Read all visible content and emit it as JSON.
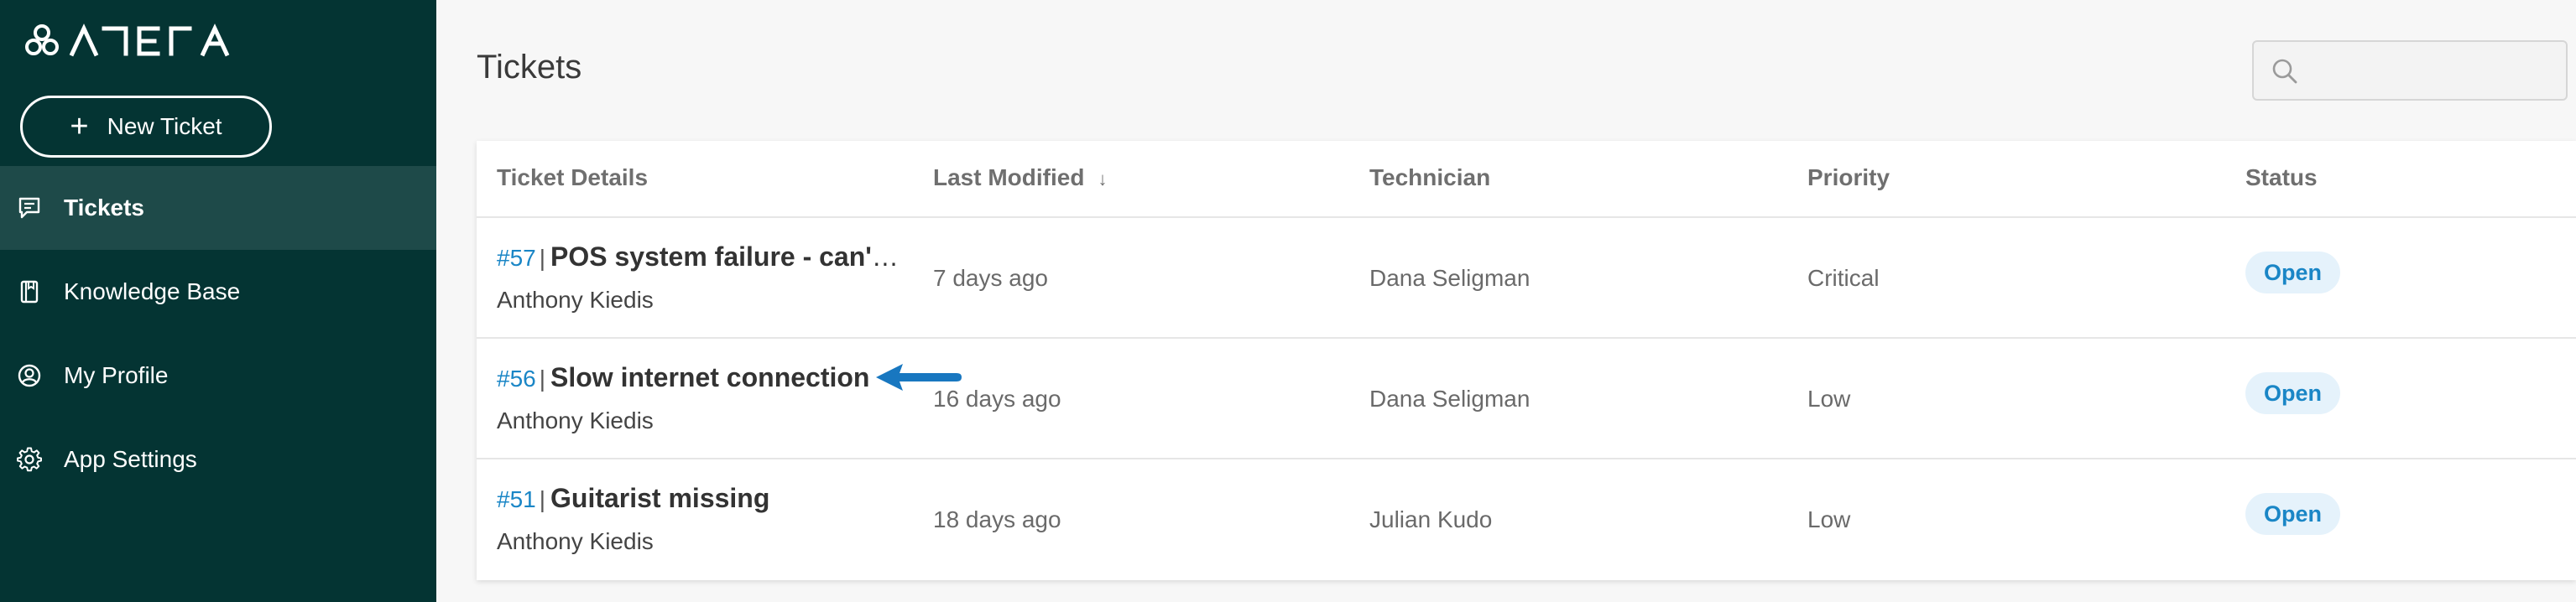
{
  "app": {
    "logo_text": "ATERA",
    "accent": "#1a86c6",
    "sidebar_bg": "#043433"
  },
  "sidebar": {
    "new_ticket_label": "New Ticket",
    "items": [
      {
        "label": "Tickets",
        "icon": "ticket-icon",
        "active": true
      },
      {
        "label": "Knowledge Base",
        "icon": "book-icon",
        "active": false
      },
      {
        "label": "My Profile",
        "icon": "profile-icon",
        "active": false
      },
      {
        "label": "App Settings",
        "icon": "gear-icon",
        "active": false
      }
    ]
  },
  "main": {
    "title": "Tickets",
    "search": {
      "placeholder": ""
    },
    "columns": [
      "Ticket Details",
      "Last Modified",
      "Technician",
      "Priority",
      "Status"
    ],
    "sort_indicator": "↓",
    "rows": [
      {
        "id": "#57",
        "separator": "|",
        "title": "POS system failure - can't …",
        "author": "Anthony Kiedis",
        "modified": "7 days ago",
        "technician": "Dana Seligman",
        "priority": "Critical",
        "status": "Open"
      },
      {
        "id": "#56",
        "separator": "|",
        "title": "Slow internet connection",
        "author": "Anthony Kiedis",
        "modified": "16 days ago",
        "technician": "Dana Seligman",
        "priority": "Low",
        "status": "Open"
      },
      {
        "id": "#51",
        "separator": "|",
        "title": "Guitarist missing",
        "author": "Anthony Kiedis",
        "modified": "18 days ago",
        "technician": "Julian Kudo",
        "priority": "Low",
        "status": "Open"
      }
    ]
  }
}
